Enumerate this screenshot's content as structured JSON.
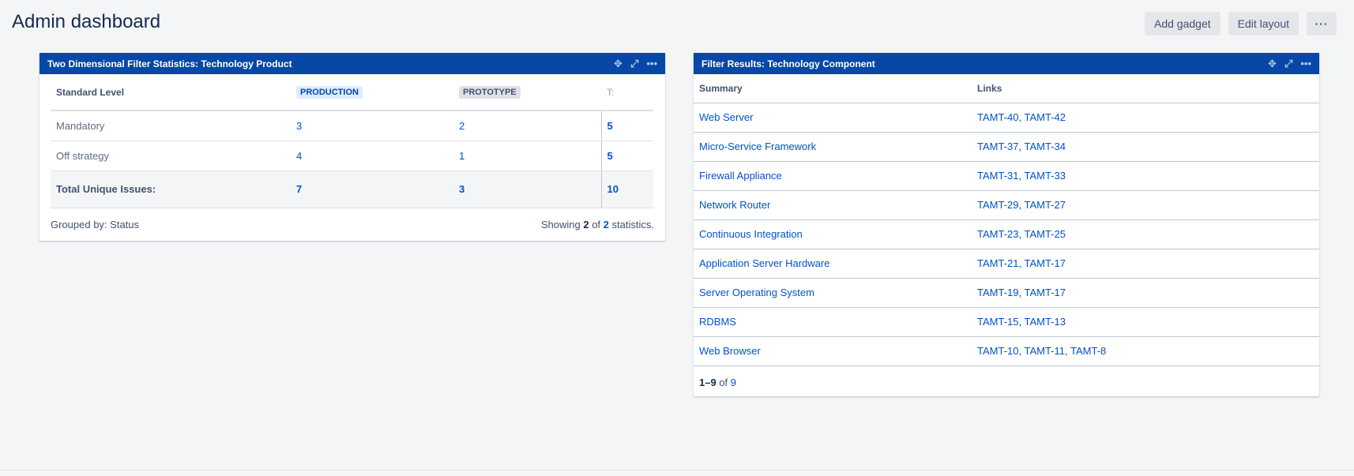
{
  "page": {
    "title": "Admin dashboard"
  },
  "toolbar": {
    "add_gadget": "Add gadget",
    "edit_layout": "Edit layout",
    "more": "···"
  },
  "gadget_left": {
    "title": "Two Dimensional Filter Statistics: Technology Product",
    "headers": {
      "level": "Standard Level",
      "production": "PRODUCTION",
      "prototype": "PROTOTYPE",
      "total": "T:"
    },
    "rows": [
      {
        "level": "Mandatory",
        "production": "3",
        "prototype": "2",
        "total": "5"
      },
      {
        "level": "Off strategy",
        "production": "4",
        "prototype": "1",
        "total": "5"
      }
    ],
    "totals": {
      "label": "Total Unique Issues:",
      "production": "7",
      "prototype": "3",
      "total": "10"
    },
    "footer": {
      "grouped_by": "Grouped by: Status",
      "showing_prefix": "Showing",
      "shown": "2",
      "of": "of",
      "count": "2",
      "suffix": "statistics."
    }
  },
  "gadget_right": {
    "title": "Filter Results: Technology Component",
    "headers": {
      "summary": "Summary",
      "links": "Links"
    },
    "rows": [
      {
        "summary": "Web Server",
        "links": "TAMT-40, TAMT-42"
      },
      {
        "summary": "Micro-Service Framework",
        "links": "TAMT-37, TAMT-34"
      },
      {
        "summary": "Firewall Appliance",
        "links": "TAMT-31, TAMT-33"
      },
      {
        "summary": "Network Router",
        "links": "TAMT-29, TAMT-27"
      },
      {
        "summary": "Continuous Integration",
        "links": "TAMT-23, TAMT-25"
      },
      {
        "summary": "Application Server Hardware",
        "links": "TAMT-21, TAMT-17"
      },
      {
        "summary": "Server Operating System",
        "links": "TAMT-19, TAMT-17"
      },
      {
        "summary": "RDBMS",
        "links": "TAMT-15, TAMT-13"
      },
      {
        "summary": "Web Browser",
        "links": "TAMT-10, TAMT-11, TAMT-8"
      }
    ],
    "pager": {
      "range": "1–9",
      "of": "of",
      "total": "9"
    }
  },
  "icons": {
    "move": "move-icon",
    "expand": "expand-icon",
    "more": "more-icon"
  },
  "colors": {
    "header_blue": "#0747a6",
    "link": "#0052cc",
    "background": "#f4f5f7"
  }
}
